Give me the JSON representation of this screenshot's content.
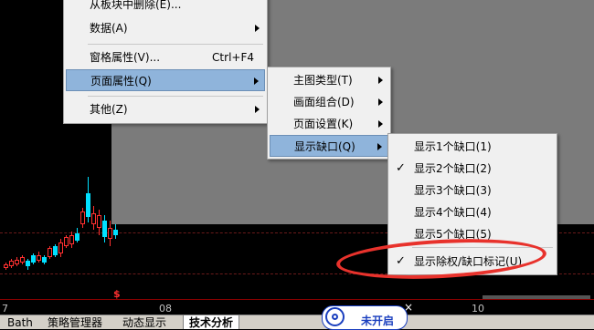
{
  "main_menu": {
    "items": [
      {
        "label": "从板块中删除(E)...",
        "shortcut": "",
        "has_submenu": false
      },
      {
        "label": "数据(A)",
        "shortcut": "",
        "has_submenu": true
      },
      {
        "label": "窗格属性(V)...",
        "shortcut": "Ctrl+F4",
        "has_submenu": false
      },
      {
        "label": "页面属性(Q)",
        "shortcut": "",
        "has_submenu": true,
        "highlighted": true
      },
      {
        "label": "其他(Z)",
        "shortcut": "",
        "has_submenu": true
      }
    ]
  },
  "page_submenu": {
    "items": [
      {
        "label": "主图类型(T)"
      },
      {
        "label": "画面组合(D)"
      },
      {
        "label": "页面设置(K)"
      },
      {
        "label": "显示缺口(Q)",
        "highlighted": true
      }
    ]
  },
  "gap_submenu": {
    "items": [
      {
        "label": "显示1个缺口(1)",
        "checked": false
      },
      {
        "label": "显示2个缺口(2)",
        "checked": true
      },
      {
        "label": "显示3个缺口(3)",
        "checked": false
      },
      {
        "label": "显示4个缺口(4)",
        "checked": false
      },
      {
        "label": "显示5个缺口(5)",
        "checked": false
      },
      {
        "label": "显示除权/缺口标记(U)",
        "checked": true
      }
    ],
    "check_glyph": "✓"
  },
  "chart": {
    "axis_labels": [
      "7",
      "08",
      "10"
    ],
    "marker": "$",
    "close_mark": "×"
  },
  "bottom_tabs": [
    {
      "label": "Bath"
    },
    {
      "label": "策略管理器"
    },
    {
      "label": "动态显示"
    },
    {
      "label": "技术分析",
      "active": true
    }
  ],
  "status": {
    "label": "未开启"
  },
  "colors": {
    "up": "#ff3030",
    "down": "#00e0ff",
    "highlight_ring": "#e8322c",
    "menu_highlight": "#8fb4db",
    "status_blue": "#1a3fbf"
  }
}
